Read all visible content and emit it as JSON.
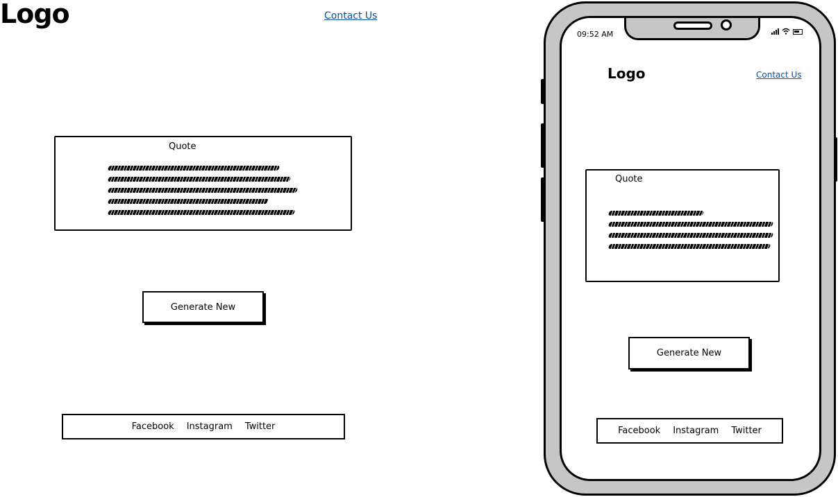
{
  "desktop": {
    "logo": "Logo",
    "contact_link": "Contact Us",
    "quote": {
      "title": "Quote"
    },
    "generate_button": "Generate New",
    "footer": {
      "links": [
        "Facebook",
        "Instagram",
        "Twitter"
      ]
    }
  },
  "mobile": {
    "status_bar": {
      "time": "09:52 AM",
      "icons": [
        "signal-icon",
        "wifi-icon",
        "battery-icon"
      ]
    },
    "logo": "Logo",
    "contact_link": "Contact Us",
    "quote": {
      "title": "Quote"
    },
    "generate_button": "Generate New",
    "footer": {
      "links": [
        "Facebook",
        "Instagram",
        "Twitter"
      ]
    }
  },
  "colors": {
    "link": "#0b4fa2",
    "device_frame": "#c6c6c6"
  }
}
